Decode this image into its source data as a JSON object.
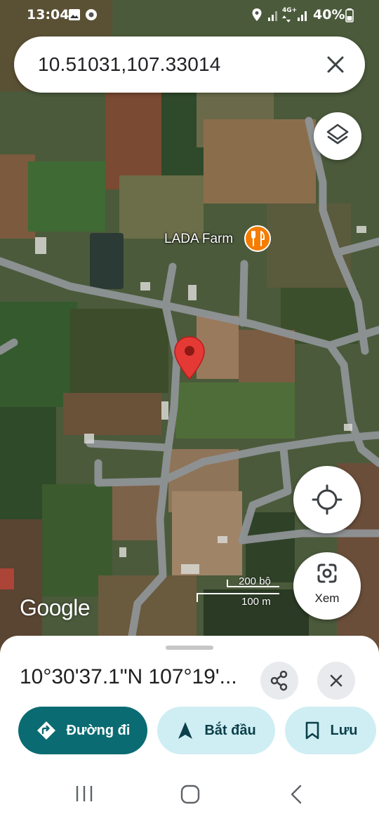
{
  "status_bar": {
    "time": "13:04",
    "battery": "40%",
    "network": "4G+"
  },
  "search": {
    "query": "10.51031,107.33014"
  },
  "map": {
    "poi_name": "LADA Farm",
    "poi_icon": "restaurant-icon",
    "scale_top": "200 bộ",
    "scale_bottom": "100 m",
    "attribution": "Google",
    "view_label": "Xem"
  },
  "sheet": {
    "coordinates": "10°30'37.1\"N 107°19'...",
    "buttons": {
      "directions": "Đường đi",
      "start": "Bắt đầu",
      "save": "Lưu"
    }
  },
  "colors": {
    "primary": "#0b6b72",
    "tonal": "#cfeef3",
    "pin": "#e53935",
    "poi": "#f57c00"
  }
}
